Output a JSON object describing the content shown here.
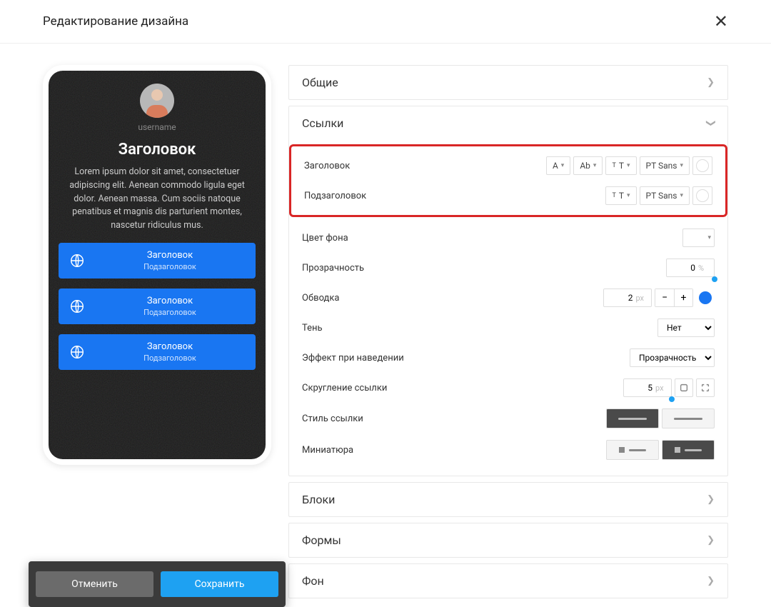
{
  "header": {
    "title": "Редактирование дизайна"
  },
  "preview": {
    "username": "username",
    "title": "Заголовок",
    "description": "Lorem ipsum dolor sit amet, consectetuer adipiscing elit. Aenean commodo ligula eget dolor. Aenean massa. Cum sociis natoque penatibus et magnis dis parturient montes, nascetur ridiculus mus.",
    "links": [
      {
        "title": "Заголовок",
        "subtitle": "Подзаголовок"
      },
      {
        "title": "Заголовок",
        "subtitle": "Подзаголовок"
      },
      {
        "title": "Заголовок",
        "subtitle": "Подзаголовок"
      }
    ]
  },
  "actions": {
    "cancel": "Отменить",
    "save": "Сохранить"
  },
  "panels": {
    "general": "Общие",
    "links": "Ссылки",
    "blocks": "Блоки",
    "forms": "Формы",
    "background": "Фон"
  },
  "links_section": {
    "heading": {
      "label": "Заголовок",
      "color_glyph": "A",
      "case_glyph": "Ab",
      "font": "PT Sans"
    },
    "subheading": {
      "label": "Подзаголовок",
      "font": "PT Sans"
    },
    "bg_color": {
      "label": "Цвет фона",
      "value_hex": "#1976f2"
    },
    "opacity": {
      "label": "Прозрачность",
      "value": 0,
      "unit": "%"
    },
    "stroke": {
      "label": "Обводка",
      "value": 2,
      "unit": "px",
      "color_hex": "#1976f2"
    },
    "shadow": {
      "label": "Тень",
      "value": "Нет"
    },
    "hover_effect": {
      "label": "Эффект при наведении",
      "value": "Прозрачность"
    },
    "border_radius": {
      "label": "Скругление ссылки",
      "value": 5,
      "unit": "px"
    },
    "link_style": {
      "label": "Стиль ссылки"
    },
    "thumbnail": {
      "label": "Миниатюра"
    }
  }
}
